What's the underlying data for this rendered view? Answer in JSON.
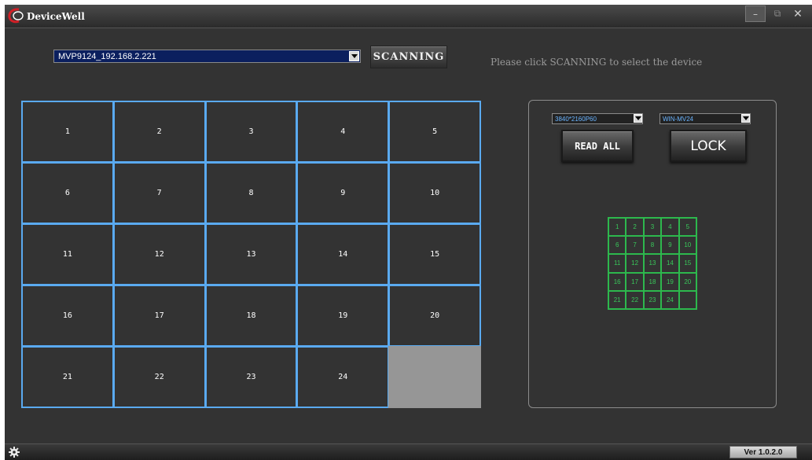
{
  "window": {
    "title": "DeviceWell",
    "buttons": {
      "minimize": "–",
      "restore": "⧉",
      "close": "✕"
    }
  },
  "toolbar": {
    "device_selected": "MVP9124_192.168.2.221",
    "scan_label": "SCANNING",
    "instruction": "Please click SCANNING to select the device"
  },
  "main_grid": {
    "cells": [
      "1",
      "2",
      "3",
      "4",
      "5",
      "6",
      "7",
      "8",
      "9",
      "10",
      "11",
      "12",
      "13",
      "14",
      "15",
      "16",
      "17",
      "18",
      "19",
      "20",
      "21",
      "22",
      "23",
      "24",
      ""
    ],
    "border_color": "#5aaaf0"
  },
  "panel": {
    "resolution_selected": "3840*2160P60",
    "model_selected": "WIN-MV24",
    "read_all_label": "READ ALL",
    "lock_label": "LOCK",
    "mini_cells": [
      "1",
      "2",
      "3",
      "4",
      "5",
      "6",
      "7",
      "8",
      "9",
      "10",
      "11",
      "12",
      "13",
      "14",
      "15",
      "16",
      "17",
      "18",
      "19",
      "20",
      "21",
      "22",
      "23",
      "24",
      ""
    ],
    "mini_color": "#2db84d"
  },
  "footer": {
    "version": "Ver 1.0.2.0",
    "icon": "gear-icon"
  },
  "colors": {
    "background": "#333333",
    "accent_blue": "#5aaaf0",
    "accent_green": "#2db84d",
    "logo_red": "#d01f26"
  }
}
